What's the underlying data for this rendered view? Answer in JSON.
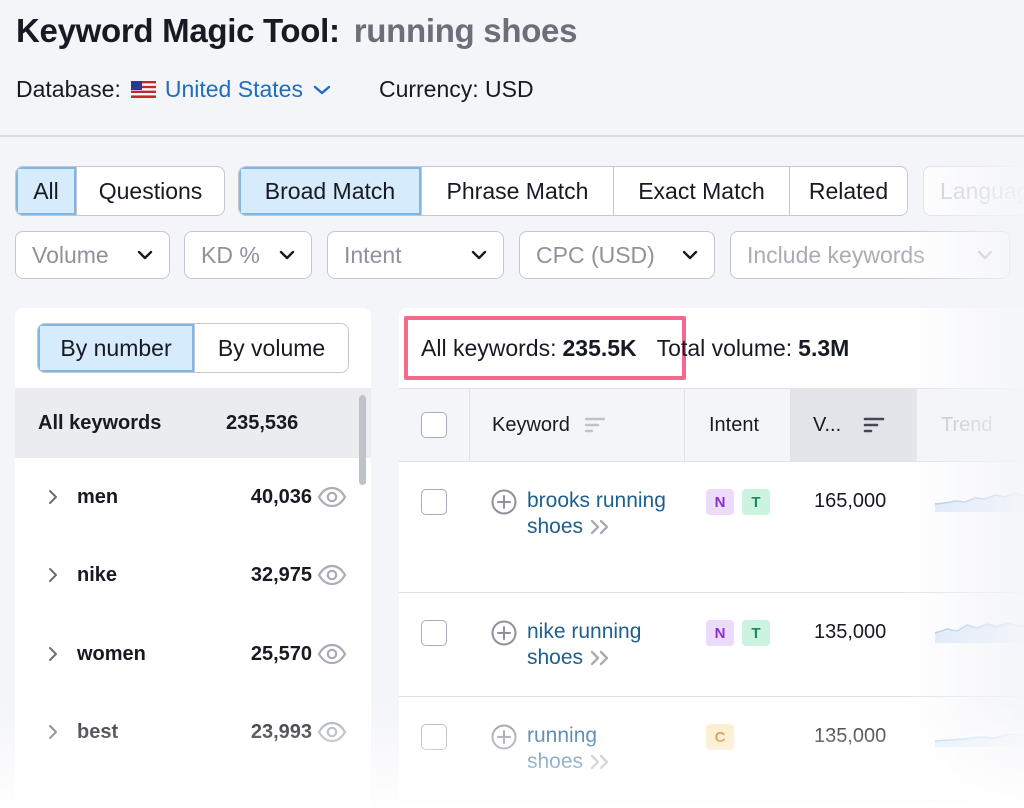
{
  "header": {
    "title": "Keyword Magic Tool:",
    "query": "running shoes",
    "database_label": "Database:",
    "database_value": "United States",
    "currency": "Currency: USD"
  },
  "match_tabs": {
    "group1": [
      "All",
      "Questions"
    ],
    "group2": [
      "Broad Match",
      "Phrase Match",
      "Exact Match",
      "Related"
    ],
    "languages": "Languages",
    "active": [
      "All",
      "Broad Match"
    ]
  },
  "filters": [
    "Volume",
    "KD %",
    "Intent",
    "CPC (USD)",
    "Include keywords"
  ],
  "groups_panel": {
    "tabs": [
      "By number",
      "By volume"
    ],
    "active_tab": "By number",
    "all_label": "All keywords",
    "all_count": "235,536",
    "items": [
      {
        "label": "men",
        "count": "40,036"
      },
      {
        "label": "nike",
        "count": "32,975"
      },
      {
        "label": "women",
        "count": "25,570"
      },
      {
        "label": "best",
        "count": "23,993"
      }
    ]
  },
  "results": {
    "all_keywords_label": "All keywords:",
    "all_keywords_value": "235.5K",
    "total_volume_label": "Total volume:",
    "total_volume_value": "5.3M",
    "columns": [
      "Keyword",
      "Intent",
      "V...",
      "Trend"
    ],
    "rows": [
      {
        "keyword": "brooks running shoes",
        "intent": [
          "N",
          "T"
        ],
        "volume": "165,000"
      },
      {
        "keyword": "nike running shoes",
        "intent": [
          "N",
          "T"
        ],
        "volume": "135,000"
      },
      {
        "keyword": "running shoes",
        "intent": [
          "C"
        ],
        "volume": "135,000"
      }
    ]
  },
  "colors": {
    "accent_blue": "#1e6ebe",
    "active_tab_bg": "#d6ebfb",
    "highlight_border": "#f2698c",
    "intent_N": "#8a2fcc",
    "intent_T": "#1d8a55",
    "intent_C": "#c98517"
  }
}
